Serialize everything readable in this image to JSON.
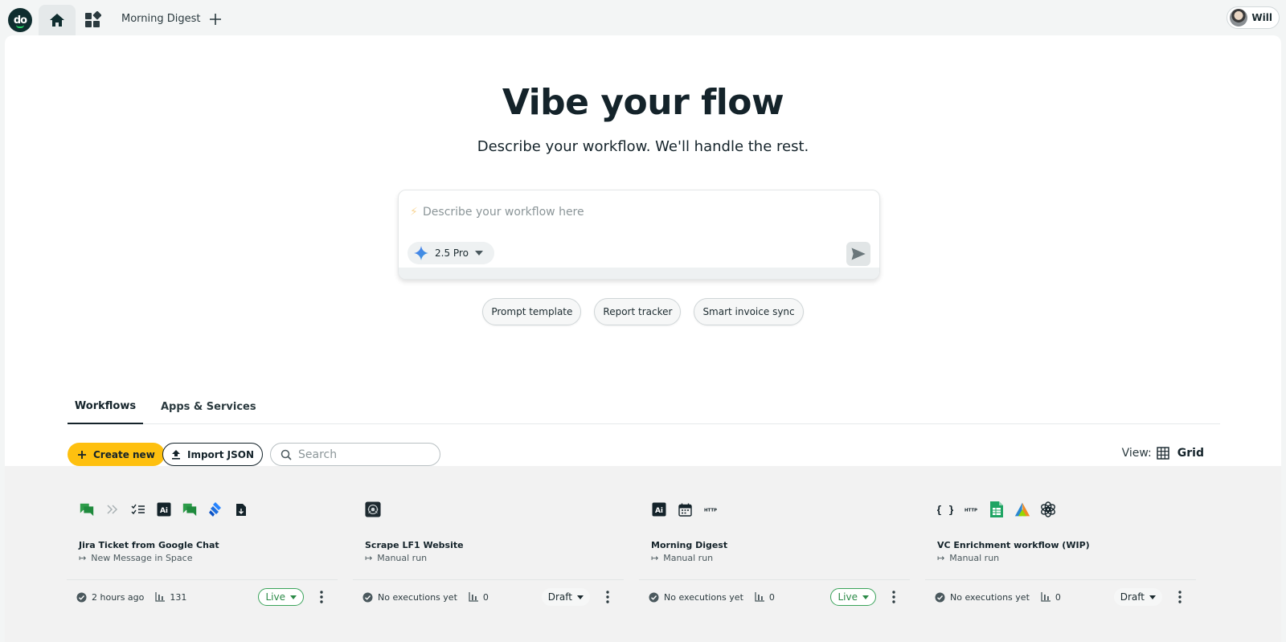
{
  "topbar": {
    "logo_text": "do",
    "doc_tab_label": "Morning Digest",
    "user_name": "Will"
  },
  "hero": {
    "title": "Vibe your flow",
    "subtitle": "Describe your workflow. We'll handle the rest."
  },
  "prompt": {
    "placeholder": "Describe your workflow here",
    "model_label": "2.5 Pro"
  },
  "chips": [
    "Prompt template",
    "Report tracker",
    "Smart invoice sync"
  ],
  "tabs": {
    "active": "Workflows",
    "inactive": "Apps & Services"
  },
  "toolbar": {
    "create_label": "Create new",
    "import_label": "Import JSON",
    "search_placeholder": "Search",
    "view_label": "View:",
    "grid_label": "Grid"
  },
  "colors": {
    "brand": "#0f2d2f",
    "accent": "#fec00f",
    "live": "#3aa35a"
  },
  "workflows": [
    {
      "title": "Jira Ticket from Google Chat",
      "trigger": "New Message in Space",
      "last_run": "2 hours ago",
      "executions": "131",
      "state": "Live",
      "icons": [
        "google-chat-icon",
        "chevron-double-right-icon",
        "checklist-icon",
        "ai-icon",
        "google-chat-icon",
        "jira-icon",
        "file-arrow-icon"
      ]
    },
    {
      "title": "Scrape LF1 Website",
      "trigger": "Manual run",
      "last_run": "No executions yet",
      "executions": "0",
      "state": "Draft",
      "icons": [
        "scraper-icon"
      ]
    },
    {
      "title": "Morning Digest",
      "trigger": "Manual run",
      "last_run": "No executions yet",
      "executions": "0",
      "state": "Live",
      "icons": [
        "ai-icon",
        "calendar-icon",
        "http-icon"
      ]
    },
    {
      "title": "VC Enrichment workflow (WIP)",
      "trigger": "Manual run",
      "last_run": "No executions yet",
      "executions": "0",
      "state": "Draft",
      "icons": [
        "code-braces-icon",
        "http-icon",
        "google-sheets-icon",
        "apify-icon",
        "openai-icon"
      ]
    }
  ],
  "icon_text": {
    "ai": "Ai",
    "http": "HTTP",
    "braces": "{ }"
  }
}
